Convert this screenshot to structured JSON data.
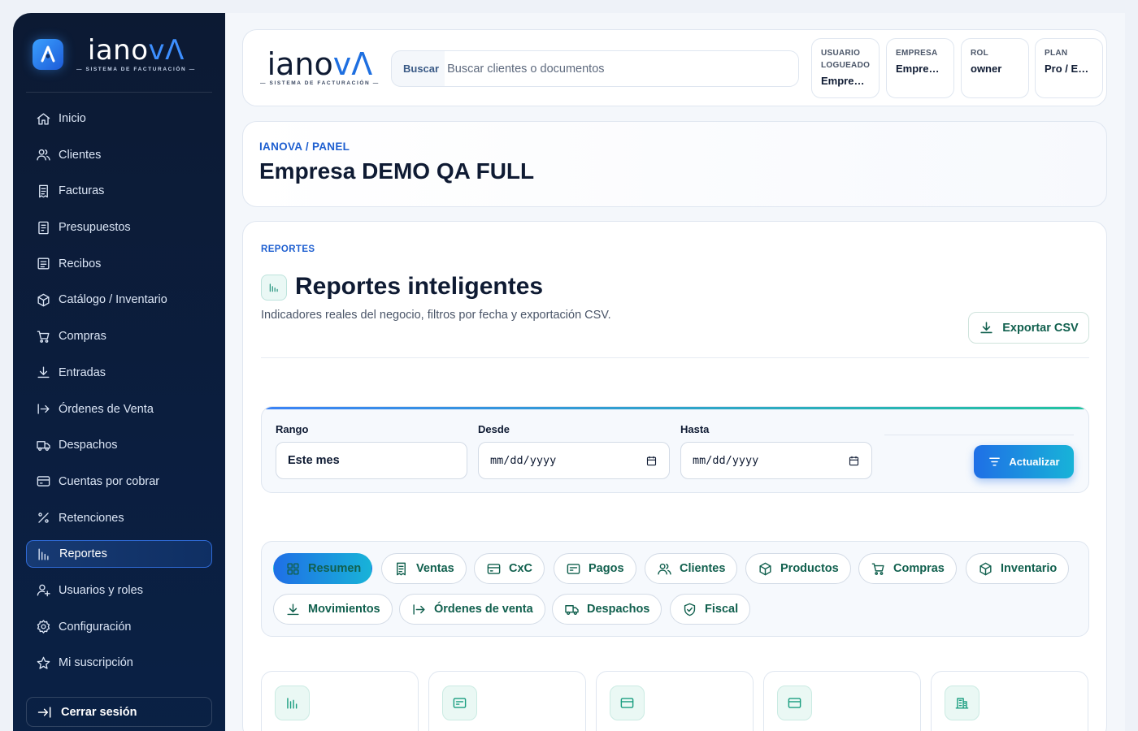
{
  "brand": {
    "word_main": "iano",
    "word_accent": "vΛ",
    "tagline": "— SISTEMA DE FACTURACIÓN —"
  },
  "sidebar": {
    "items": [
      {
        "label": "Inicio",
        "icon": "home-icon"
      },
      {
        "label": "Clientes",
        "icon": "users-icon"
      },
      {
        "label": "Facturas",
        "icon": "invoice-icon"
      },
      {
        "label": "Presupuestos",
        "icon": "quote-icon"
      },
      {
        "label": "Recibos",
        "icon": "receipt-icon"
      },
      {
        "label": "Catálogo / Inventario",
        "icon": "box-icon"
      },
      {
        "label": "Compras",
        "icon": "cart-icon"
      },
      {
        "label": "Entradas",
        "icon": "download-icon"
      },
      {
        "label": "Órdenes de Venta",
        "icon": "arrow-right-bar-icon"
      },
      {
        "label": "Despachos",
        "icon": "truck-icon"
      },
      {
        "label": "Cuentas por cobrar",
        "icon": "card-icon"
      },
      {
        "label": "Retenciones",
        "icon": "percent-icon"
      },
      {
        "label": "Reportes",
        "icon": "bar-chart-icon",
        "active": true
      },
      {
        "label": "Usuarios y roles",
        "icon": "user-cog-icon"
      },
      {
        "label": "Configuración",
        "icon": "settings-icon"
      },
      {
        "label": "Mi suscripción",
        "icon": "star-icon"
      }
    ],
    "logout_label": "Cerrar sesión"
  },
  "topbar": {
    "search_label": "Buscar",
    "search_placeholder": "Buscar clientes o documentos",
    "meta": [
      {
        "key": "USUARIO LOGUEADO",
        "value": "Empresa DEMO QA FULL"
      },
      {
        "key": "EMPRESA",
        "value": "Empresa DEMO QA FULL"
      },
      {
        "key": "ROL",
        "value": "owner"
      },
      {
        "key": "PLAN",
        "value": "Pro / Empresarial"
      }
    ]
  },
  "header": {
    "breadcrumb": "IANOVA / PANEL",
    "title": "Empresa DEMO QA FULL"
  },
  "reports": {
    "eyebrow": "REPORTES",
    "title": "Reportes inteligentes",
    "description": "Indicadores reales del negocio, filtros por fecha y exportación CSV.",
    "export_label": "Exportar CSV",
    "filters": {
      "range_label": "Rango",
      "range_value": "Este mes",
      "from_label": "Desde",
      "from_value": "mm/dd/yyyy",
      "to_label": "Hasta",
      "to_value": "mm/dd/yyyy",
      "update_label": "Actualizar"
    },
    "tabs": [
      {
        "label": "Resumen",
        "icon": "grid-icon",
        "active": true
      },
      {
        "label": "Ventas",
        "icon": "invoice-icon"
      },
      {
        "label": "CxC",
        "icon": "card-icon"
      },
      {
        "label": "Pagos",
        "icon": "payment-icon"
      },
      {
        "label": "Clientes",
        "icon": "users-icon"
      },
      {
        "label": "Productos",
        "icon": "box-icon"
      },
      {
        "label": "Compras",
        "icon": "cart-icon"
      },
      {
        "label": "Inventario",
        "icon": "box-icon"
      },
      {
        "label": "Movimientos",
        "icon": "download-icon"
      },
      {
        "label": "Órdenes de venta",
        "icon": "arrow-right-bar-icon"
      },
      {
        "label": "Despachos",
        "icon": "truck-icon"
      },
      {
        "label": "Fiscal",
        "icon": "shield-check-icon"
      }
    ],
    "kpi_icons": [
      "bar-chart-icon",
      "payment-icon",
      "card-icon",
      "card-icon",
      "building-icon"
    ]
  },
  "colors": {
    "sidebar_bg": "#0c1a33",
    "accent_blue": "#1e6fe0",
    "accent_teal": "#11604e",
    "active_gradient_start": "#1f6fe6",
    "active_gradient_end": "#18b3d8"
  }
}
